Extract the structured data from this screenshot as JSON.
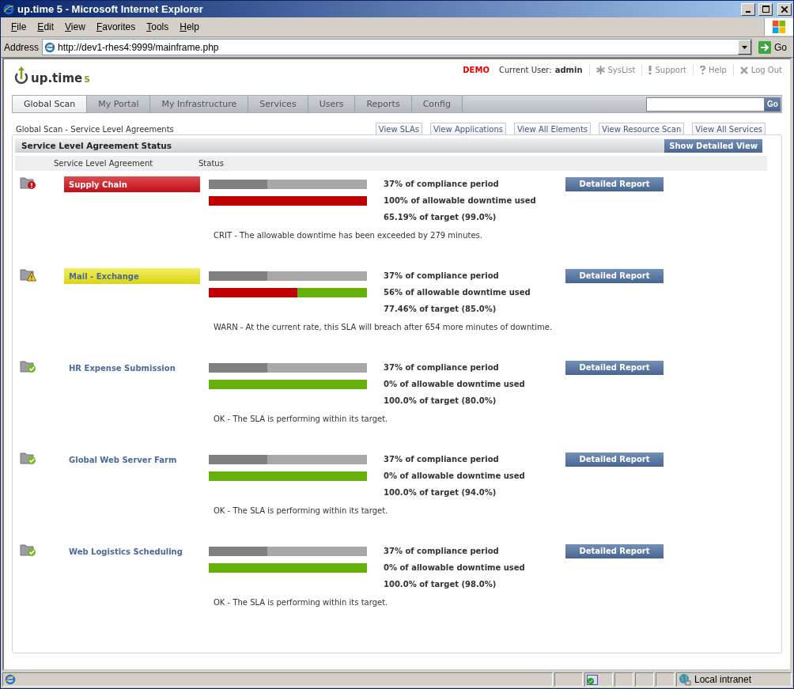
{
  "window": {
    "title": "up.time 5 - Microsoft Internet Explorer"
  },
  "menu": [
    "File",
    "Edit",
    "View",
    "Favorites",
    "Tools",
    "Help"
  ],
  "address_bar": {
    "label": "Address",
    "url": "http://dev1-rhes4:9999/mainframe.php",
    "go": "Go"
  },
  "header": {
    "logo": "up.time",
    "logo_version": "5",
    "demo": "DEMO",
    "user_label": "Current User:",
    "user": "admin",
    "links": [
      {
        "label": "SysList",
        "kind": "syslist"
      },
      {
        "label": "Support",
        "kind": "support"
      },
      {
        "label": "Help",
        "kind": "help"
      },
      {
        "label": "Log Out",
        "kind": "logout"
      }
    ]
  },
  "tabs": [
    {
      "label": "Global Scan",
      "selected": true
    },
    {
      "label": "My Portal",
      "selected": false
    },
    {
      "label": "My Infrastructure",
      "selected": false
    },
    {
      "label": "Services",
      "selected": false
    },
    {
      "label": "Users",
      "selected": false
    },
    {
      "label": "Reports",
      "selected": false
    },
    {
      "label": "Config",
      "selected": false
    }
  ],
  "search": {
    "go": "Go"
  },
  "breadcrumb": "Global Scan - Service Level Agreements",
  "view_buttons": [
    "View SLAs",
    "View Applications",
    "View All Elements",
    "View Resource Scan",
    "View All Services"
  ],
  "panel": {
    "title": "Service Level Agreement Status",
    "button": "Show Detailed View",
    "columns": [
      "Service Level Agreement",
      "Status"
    ]
  },
  "slas": [
    {
      "name": "Supply Chain",
      "kind": "crit",
      "compliance": {
        "level": 0.37
      },
      "downtime": {
        "level": 1
      },
      "compliance_text": "37% of compliance period",
      "downtime_text": "100% of allowable downtime used",
      "target_text": "65.19% of target (99.0%)",
      "message": "CRIT - The allowable downtime has been exceeded by 279 minutes.",
      "button": "Detailed Report"
    },
    {
      "name": "Mail - Exchange",
      "kind": "warn",
      "compliance": {
        "level": 0.37
      },
      "downtime": {
        "level": 0.56
      },
      "compliance_text": "37% of compliance period",
      "downtime_text": "56% of allowable downtime used",
      "target_text": "77.46% of target (85.0%)",
      "message": "WARN - At the current rate, this SLA will breach after 654 more minutes of downtime.",
      "button": "Detailed Report"
    },
    {
      "name": "HR Expense Submission",
      "kind": "ok",
      "compliance": {
        "level": 0.37
      },
      "downtime": {
        "level": 0
      },
      "compliance_text": "37% of compliance period",
      "downtime_text": "0% of allowable downtime used",
      "target_text": "100.0% of target (80.0%)",
      "message": "OK - The SLA is performing within its target.",
      "button": "Detailed Report"
    },
    {
      "name": "Global Web Server Farm",
      "kind": "ok",
      "compliance": {
        "level": 0.37
      },
      "downtime": {
        "level": 0
      },
      "compliance_text": "37% of compliance period",
      "downtime_text": "0% of allowable downtime used",
      "target_text": "100.0% of target (94.0%)",
      "message": "OK - The SLA is performing within its target.",
      "button": "Detailed Report"
    },
    {
      "name": "Web Logistics Scheduling",
      "kind": "ok",
      "compliance": {
        "level": 0.37
      },
      "downtime": {
        "level": 0
      },
      "compliance_text": "37% of compliance period",
      "downtime_text": "0% of allowable downtime used",
      "target_text": "100.0% of target (98.0%)",
      "message": "OK - The SLA is performing within its target.",
      "button": "Detailed Report"
    }
  ],
  "status_bar": {
    "zone": "Local intranet"
  }
}
